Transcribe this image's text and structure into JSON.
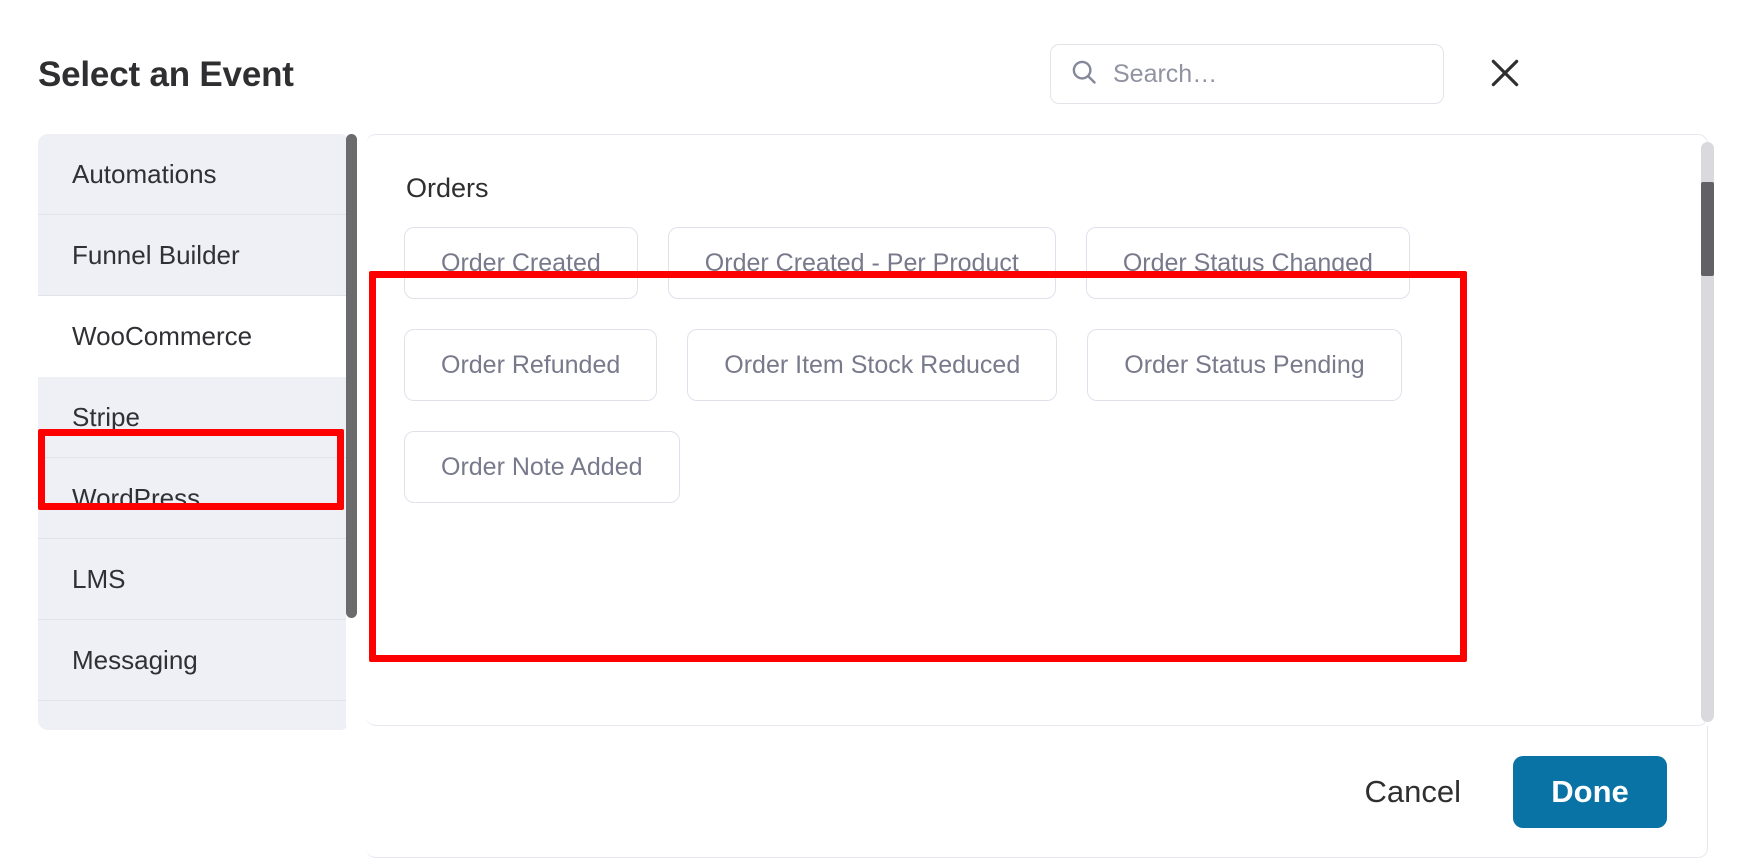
{
  "header": {
    "title": "Select an Event",
    "search": {
      "placeholder": "Search…",
      "value": "",
      "icon": "search-icon"
    },
    "close_icon": "close-icon"
  },
  "sidebar": {
    "items": [
      {
        "label": "Automations",
        "active": false
      },
      {
        "label": "Funnel Builder",
        "active": false
      },
      {
        "label": "WooCommerce",
        "active": true
      },
      {
        "label": "Stripe",
        "active": false
      },
      {
        "label": "WordPress",
        "active": false
      },
      {
        "label": "LMS",
        "active": false
      },
      {
        "label": "Messaging",
        "active": false
      }
    ]
  },
  "main": {
    "group_title": "Orders",
    "events": [
      "Order Created",
      "Order Created - Per Product",
      "Order Status Changed",
      "Order Refunded",
      "Order Item Stock Reduced",
      "Order Status Pending",
      "Order Note Added"
    ]
  },
  "footer": {
    "cancel_label": "Cancel",
    "done_label": "Done"
  },
  "colors": {
    "accent": "#0873a4",
    "annotation": "#fe0000",
    "sidebar_bg": "#eef0f6",
    "chip_text": "#787a8c"
  }
}
